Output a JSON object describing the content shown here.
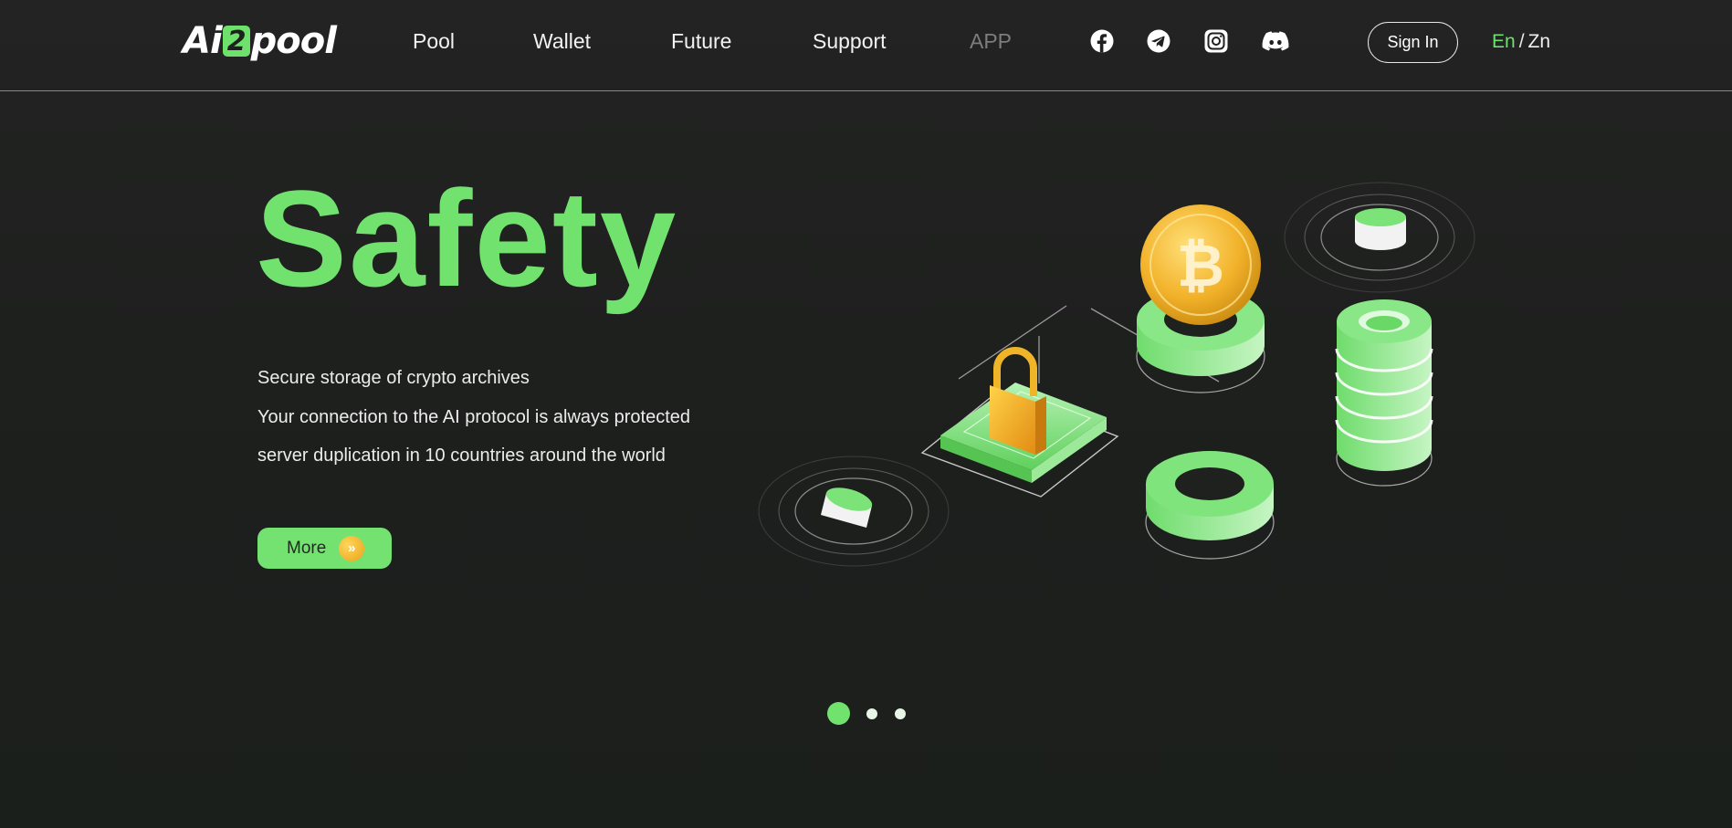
{
  "header": {
    "logo": {
      "prefix": "Ai",
      "mark": "2",
      "suffix": "pool"
    },
    "nav": [
      {
        "label": "Pool"
      },
      {
        "label": "Wallet"
      },
      {
        "label": "Future"
      },
      {
        "label": "Support"
      },
      {
        "label": "APP"
      }
    ],
    "social_icons": [
      "facebook-icon",
      "telegram-icon",
      "instagram-icon",
      "discord-icon"
    ],
    "sign_in_label": "Sign In",
    "language": {
      "en": "En",
      "separator": "/",
      "zn": "Zn"
    }
  },
  "hero": {
    "title": "Safety",
    "lines": [
      "Secure storage of crypto archives",
      "Your connection to the AI protocol is always protected",
      "server duplication in 10 countries around the world"
    ],
    "more_label": "More",
    "coin_symbol": "₿"
  },
  "carousel": {
    "slide_count": 3,
    "active_index": 0
  },
  "colors": {
    "accent": "#72e26f",
    "background": "#1e201e",
    "muted_nav": "#7c7d7c",
    "coin": "#f0b429"
  }
}
